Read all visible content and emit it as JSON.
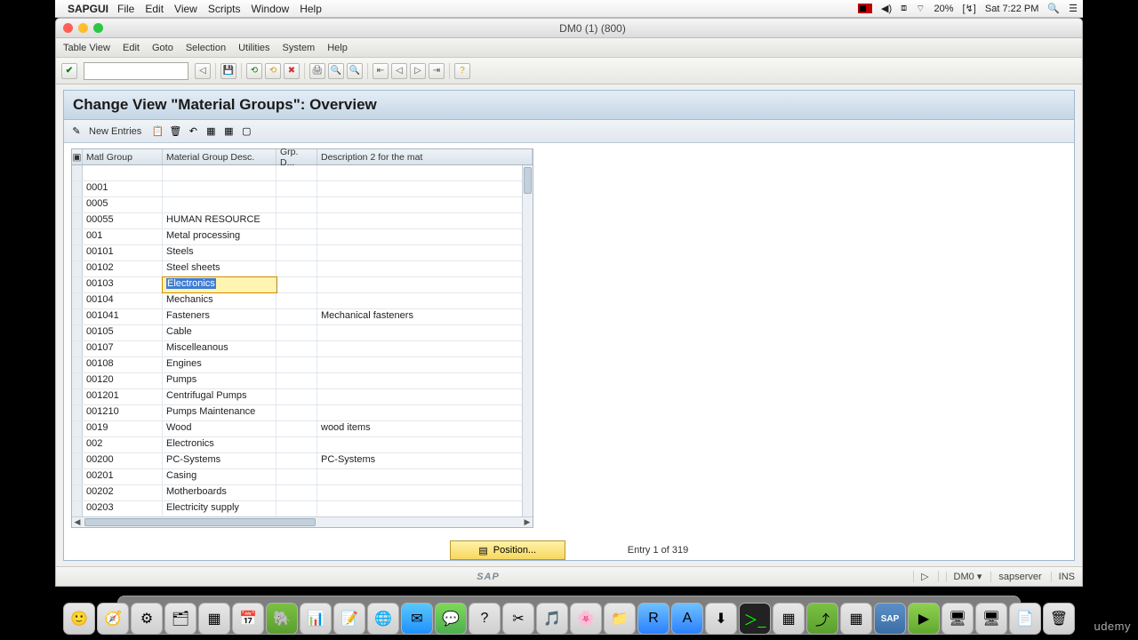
{
  "mac": {
    "app_name": "SAPGUI",
    "menu": [
      "File",
      "Edit",
      "View",
      "Scripts",
      "Window",
      "Help"
    ],
    "battery": "20%",
    "clock": "Sat 7:22 PM"
  },
  "window": {
    "title": "DM0 (1) (800)",
    "menu": [
      "Table View",
      "Edit",
      "Goto",
      "Selection",
      "Utilities",
      "System",
      "Help"
    ]
  },
  "panel": {
    "title": "Change View \"Material Groups\": Overview",
    "new_entries": "New Entries"
  },
  "grid": {
    "columns": {
      "sel": "",
      "mg": "Matl Group",
      "desc": "Material Group Desc.",
      "gd": "Grp. D...",
      "d2": "Description 2 for the mat"
    },
    "rows": [
      {
        "mg": "",
        "desc": "",
        "gd": "",
        "d2": ""
      },
      {
        "mg": "0001",
        "desc": "",
        "gd": "",
        "d2": ""
      },
      {
        "mg": "0005",
        "desc": "",
        "gd": "",
        "d2": ""
      },
      {
        "mg": "00055",
        "desc": "HUMAN RESOURCE",
        "gd": "",
        "d2": ""
      },
      {
        "mg": "001",
        "desc": "Metal processing",
        "gd": "",
        "d2": ""
      },
      {
        "mg": "00101",
        "desc": "Steels",
        "gd": "",
        "d2": ""
      },
      {
        "mg": "00102",
        "desc": "Steel sheets",
        "gd": "",
        "d2": ""
      },
      {
        "mg": "00103",
        "desc": "Electronics",
        "gd": "",
        "d2": "",
        "editing": true
      },
      {
        "mg": "00104",
        "desc": "Mechanics",
        "gd": "",
        "d2": ""
      },
      {
        "mg": "001041",
        "desc": "Fasteners",
        "gd": "",
        "d2": "Mechanical fasteners"
      },
      {
        "mg": "00105",
        "desc": "Cable",
        "gd": "",
        "d2": ""
      },
      {
        "mg": "00107",
        "desc": "Miscelleanous",
        "gd": "",
        "d2": ""
      },
      {
        "mg": "00108",
        "desc": "Engines",
        "gd": "",
        "d2": ""
      },
      {
        "mg": "00120",
        "desc": "Pumps",
        "gd": "",
        "d2": ""
      },
      {
        "mg": "001201",
        "desc": "Centrifugal Pumps",
        "gd": "",
        "d2": ""
      },
      {
        "mg": "001210",
        "desc": "Pumps Maintenance",
        "gd": "",
        "d2": ""
      },
      {
        "mg": "0019",
        "desc": "Wood",
        "gd": "",
        "d2": "wood items"
      },
      {
        "mg": "002",
        "desc": "Electronics",
        "gd": "",
        "d2": ""
      },
      {
        "mg": "00200",
        "desc": "PC-Systems",
        "gd": "",
        "d2": "PC-Systems"
      },
      {
        "mg": "00201",
        "desc": "Casing",
        "gd": "",
        "d2": ""
      },
      {
        "mg": "00202",
        "desc": "Motherboards",
        "gd": "",
        "d2": ""
      },
      {
        "mg": "00203",
        "desc": "Electricity supply",
        "gd": "",
        "d2": ""
      }
    ]
  },
  "footer": {
    "position": "Position...",
    "entry": "Entry 1 of 319"
  },
  "status": {
    "sap": "SAP",
    "system": "DM0",
    "server": "sapserver",
    "mode": "INS",
    "arrow": "▷"
  },
  "brand": "udemy"
}
